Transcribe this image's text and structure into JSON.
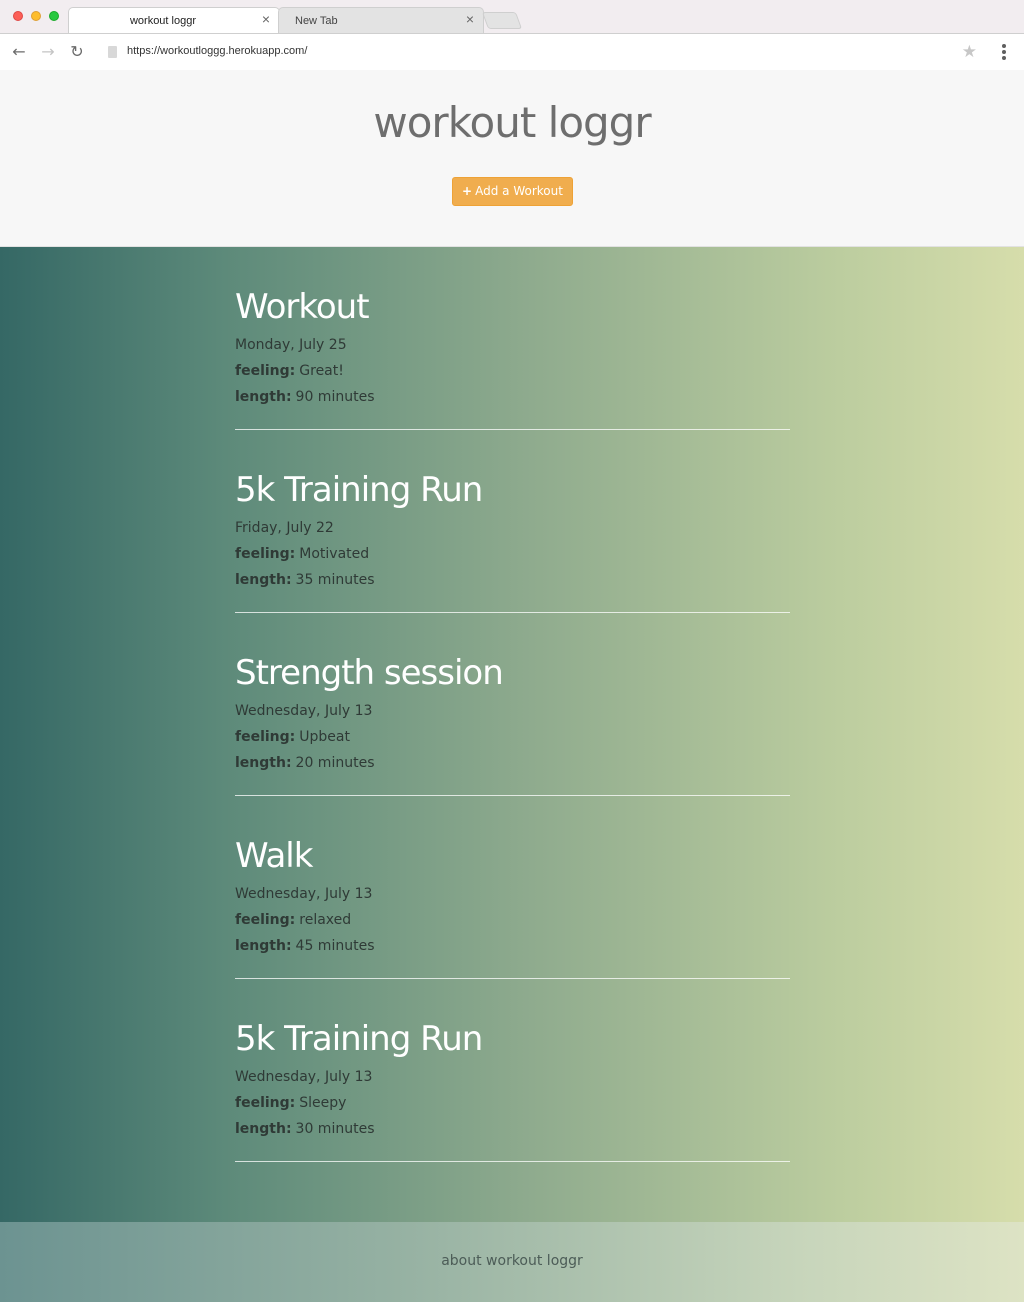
{
  "browser": {
    "tabs": [
      {
        "label": "workout loggr",
        "close_icon": "close-icon",
        "active": true
      },
      {
        "label": "New Tab",
        "close_icon": "close-icon",
        "active": false
      }
    ],
    "url": "https://workoutloggg.herokuapp.com/",
    "icons": {
      "back": "←",
      "forward": "→",
      "reload": "↻",
      "close": "×",
      "star": "★"
    },
    "colors": {
      "close_dot": "#fc5f57",
      "minimize_dot": "#fdbd2e",
      "maximize_dot": "#28c83f"
    }
  },
  "header": {
    "title": "workout loggr",
    "add_button": {
      "icon": "plus-icon",
      "icon_glyph": "+",
      "label": "Add a Workout",
      "color": "#f0ad4e"
    }
  },
  "workouts": [
    {
      "title": "Workout",
      "date": "Monday, July 25",
      "feeling_label": "feeling:",
      "feeling": "Great!",
      "length_label": "length:",
      "length": "90 minutes"
    },
    {
      "title": "5k Training Run",
      "date": "Friday, July 22",
      "feeling_label": "feeling:",
      "feeling": "Motivated",
      "length_label": "length:",
      "length": "35 minutes"
    },
    {
      "title": "Strength session",
      "date": "Wednesday, July 13",
      "feeling_label": "feeling:",
      "feeling": "Upbeat",
      "length_label": "length:",
      "length": "20 minutes"
    },
    {
      "title": "Walk",
      "date": "Wednesday, July 13",
      "feeling_label": "feeling:",
      "feeling": "relaxed",
      "length_label": "length:",
      "length": "45 minutes"
    },
    {
      "title": "5k Training Run",
      "date": "Wednesday, July 13",
      "feeling_label": "feeling:",
      "feeling": "Sleepy",
      "length_label": "length:",
      "length": "30 minutes"
    }
  ],
  "theme": {
    "gradient_start": "#356865",
    "gradient_end": "#d6ddab"
  },
  "footer": {
    "link": "about workout loggr"
  }
}
